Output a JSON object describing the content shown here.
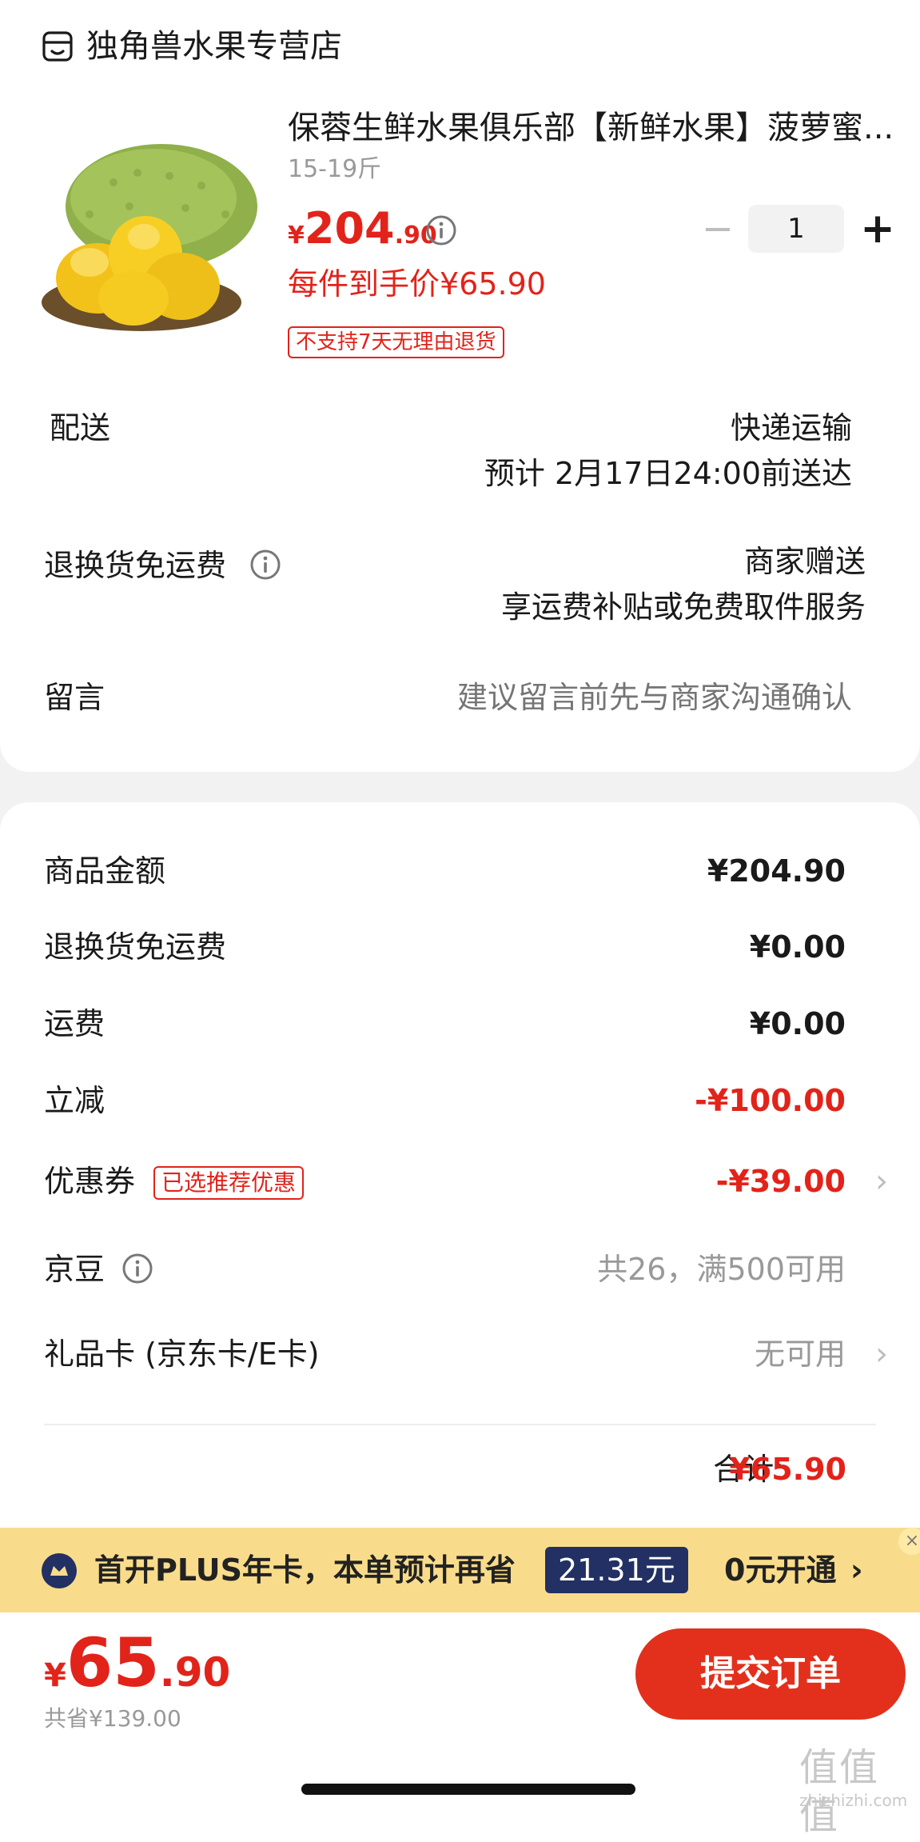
{
  "store": {
    "name": "独角兽水果专营店",
    "icon": "store-icon"
  },
  "product": {
    "title": "保蓉生鲜水果俱乐部【新鲜水果】菠萝蜜...",
    "spec": "15-19斤",
    "price_symbol": "¥",
    "price_int": "204",
    "price_dec": ".90",
    "quantity": "1",
    "per_item_price": "每件到手价¥65.90",
    "no_return_tag": "不支持7天无理由退货"
  },
  "delivery": {
    "label": "配送",
    "method": "快递运输",
    "eta": "预计 2月17日24:00前送达"
  },
  "return_shipping": {
    "label": "退换货免运费",
    "line1": "商家赠送",
    "line2": "享运费补贴或免费取件服务"
  },
  "message": {
    "label": "留言",
    "placeholder": "建议留言前先与商家沟通确认"
  },
  "summary": {
    "goods_label": "商品金额",
    "goods_value": "¥204.90",
    "return_label": "退换货免运费",
    "return_value": "¥0.00",
    "shipping_label": "运费",
    "shipping_value": "¥0.00",
    "discount_label": "立减",
    "discount_value": "-¥100.00",
    "coupon_label": "优惠券",
    "coupon_tag": "已选推荐优惠",
    "coupon_value": "-¥39.00",
    "beans_label": "京豆",
    "beans_value": "共26，满500可用",
    "giftcard_label": "礼品卡 (京东卡/E卡)",
    "giftcard_value": "无可用",
    "total_label": "合计:",
    "total_value": "¥65.90"
  },
  "plus_banner": {
    "text": "首开PLUS年卡，本单预计再省",
    "amount": "21.31元",
    "cta": "0元开通",
    "chevron": "›",
    "close": "×"
  },
  "checkout": {
    "price_symbol": "¥",
    "price_int": "65",
    "price_dec": ".90",
    "saved": "共省¥139.00",
    "submit_label": "提交订单"
  },
  "watermark": {
    "glyphs": "值值值",
    "url": "zhizhizhi.com"
  },
  "colors": {
    "accent": "#e2231a",
    "plus_navy": "#223063",
    "plus_gold": "#f9dc8b"
  }
}
